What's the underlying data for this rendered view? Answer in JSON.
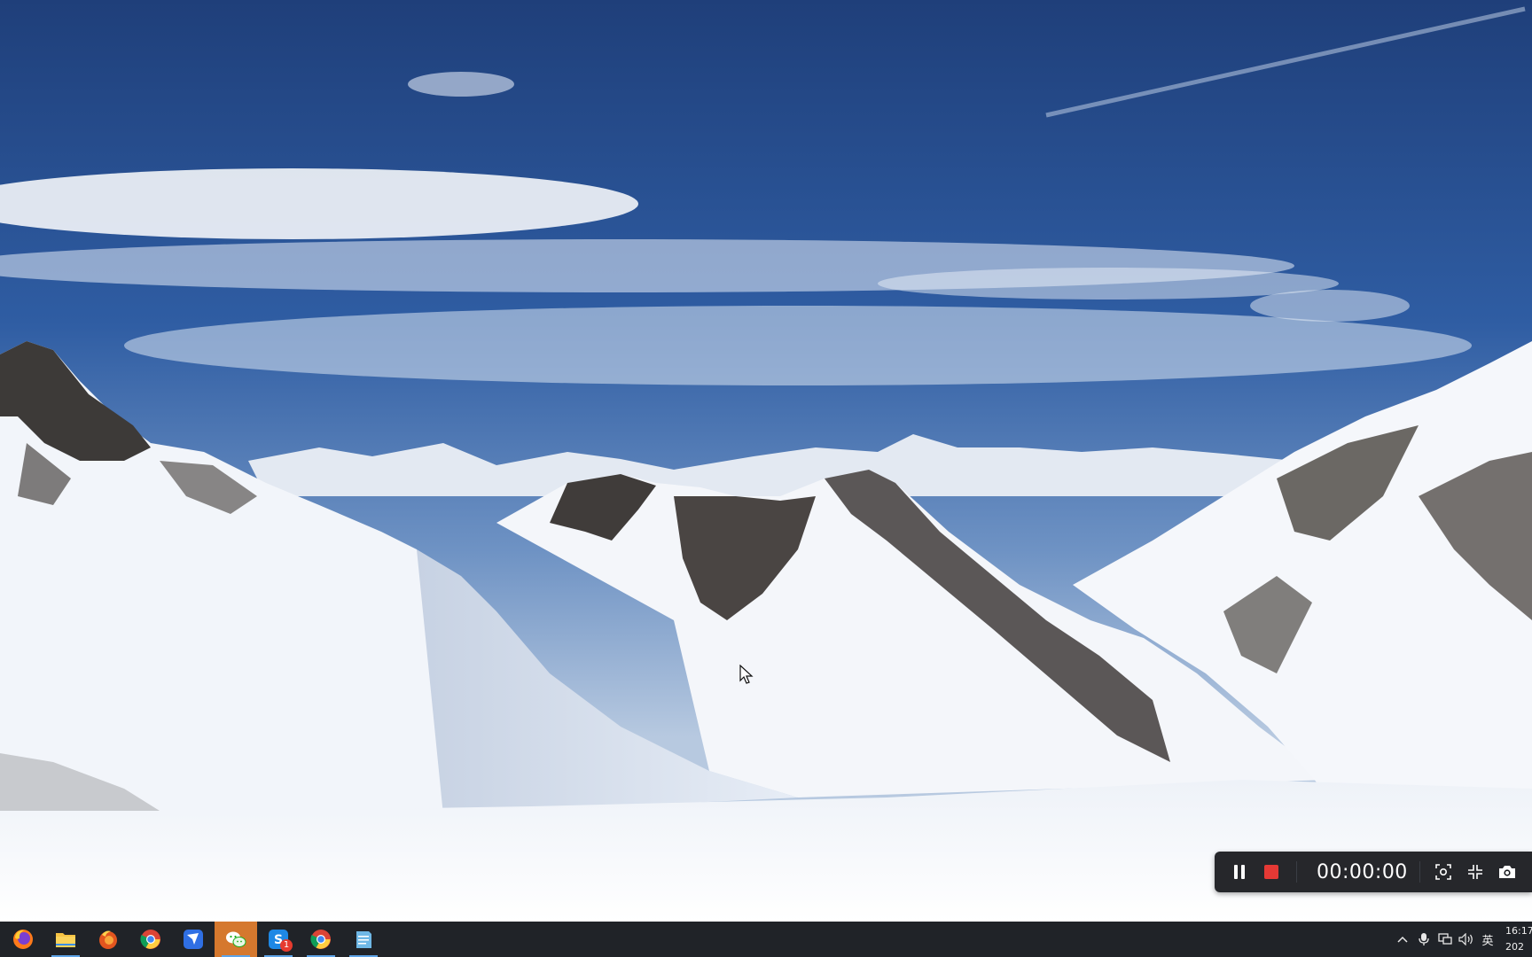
{
  "desktop": {
    "wallpaper": "snowy-mountains-blue-sky"
  },
  "recorder": {
    "timer": "00:00:00",
    "icons": [
      "pause-icon",
      "stop-icon",
      "screenshot-region-icon",
      "shrink-icon",
      "camera-icon"
    ],
    "stop_color": "#e53935"
  },
  "taskbar": {
    "apps": [
      {
        "name": "Firefox",
        "icon": "firefox-icon"
      },
      {
        "name": "File Explorer",
        "icon": "folder-icon"
      },
      {
        "name": "Firefox Nightly",
        "icon": "firefox-alt-icon"
      },
      {
        "name": "Google Chrome",
        "icon": "chrome-icon"
      },
      {
        "name": "Feishu",
        "icon": "feishu-icon"
      },
      {
        "name": "WeChat",
        "icon": "wechat-icon"
      },
      {
        "name": "Sogou",
        "icon": "sogou-icon",
        "badge": "1"
      },
      {
        "name": "Google Chrome",
        "icon": "chrome-icon"
      },
      {
        "name": "Notepad",
        "icon": "notepad-icon"
      }
    ],
    "tray": {
      "ime": "英",
      "time": "16:17",
      "date": "202"
    },
    "accent": "#5ea4e8",
    "active_color": "#d5782e"
  }
}
